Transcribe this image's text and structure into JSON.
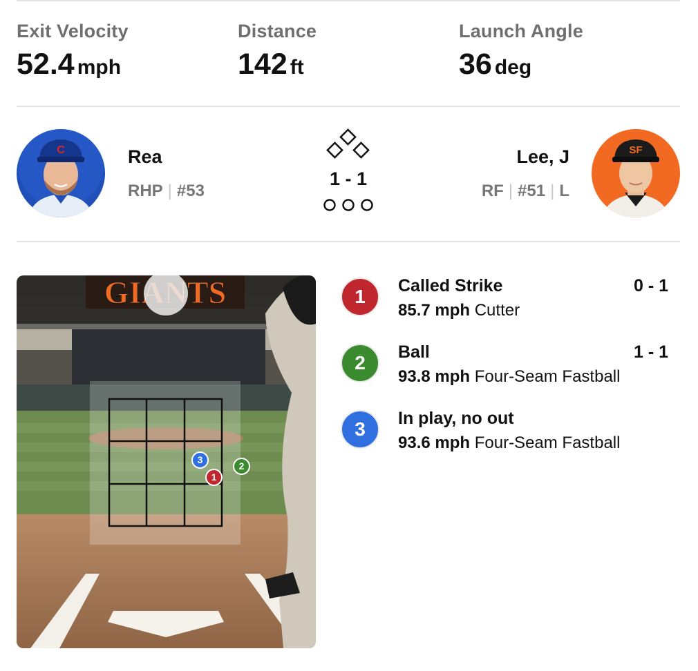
{
  "stats": [
    {
      "label": "Exit Velocity",
      "value": "52.4",
      "unit": "mph"
    },
    {
      "label": "Distance",
      "value": "142",
      "unit": "ft"
    },
    {
      "label": "Launch Angle",
      "value": "36",
      "unit": "deg"
    }
  ],
  "matchup": {
    "pitcher": {
      "name": "Rea",
      "position": "RHP",
      "number": "#53",
      "team_color": "#1f4fb8"
    },
    "batter": {
      "name": "Lee, J",
      "position": "RF",
      "number": "#51",
      "bats": "L",
      "team_color": "#f26a21"
    },
    "count": "1 - 1",
    "bases_occupied": [
      false,
      false,
      false
    ],
    "outs": 0
  },
  "pitch_view": {
    "scene_text": "GIANTS",
    "markers": [
      {
        "number": "3",
        "color": "#2f6fe0"
      },
      {
        "number": "1",
        "color": "#c0262d"
      },
      {
        "number": "2",
        "color": "#3a8a2e"
      }
    ]
  },
  "pitches": [
    {
      "number": "1",
      "result": "Called Strike",
      "count": "0 - 1",
      "speed": "85.7 mph",
      "type": "Cutter",
      "color": "#c0262d"
    },
    {
      "number": "2",
      "result": "Ball",
      "count": "1 - 1",
      "speed": "93.8 mph",
      "type": "Four-Seam Fastball",
      "color": "#3a8a2e"
    },
    {
      "number": "3",
      "result": "In play, no out",
      "count": "",
      "speed": "93.6 mph",
      "type": "Four-Seam Fastball",
      "color": "#2f6fe0"
    }
  ]
}
